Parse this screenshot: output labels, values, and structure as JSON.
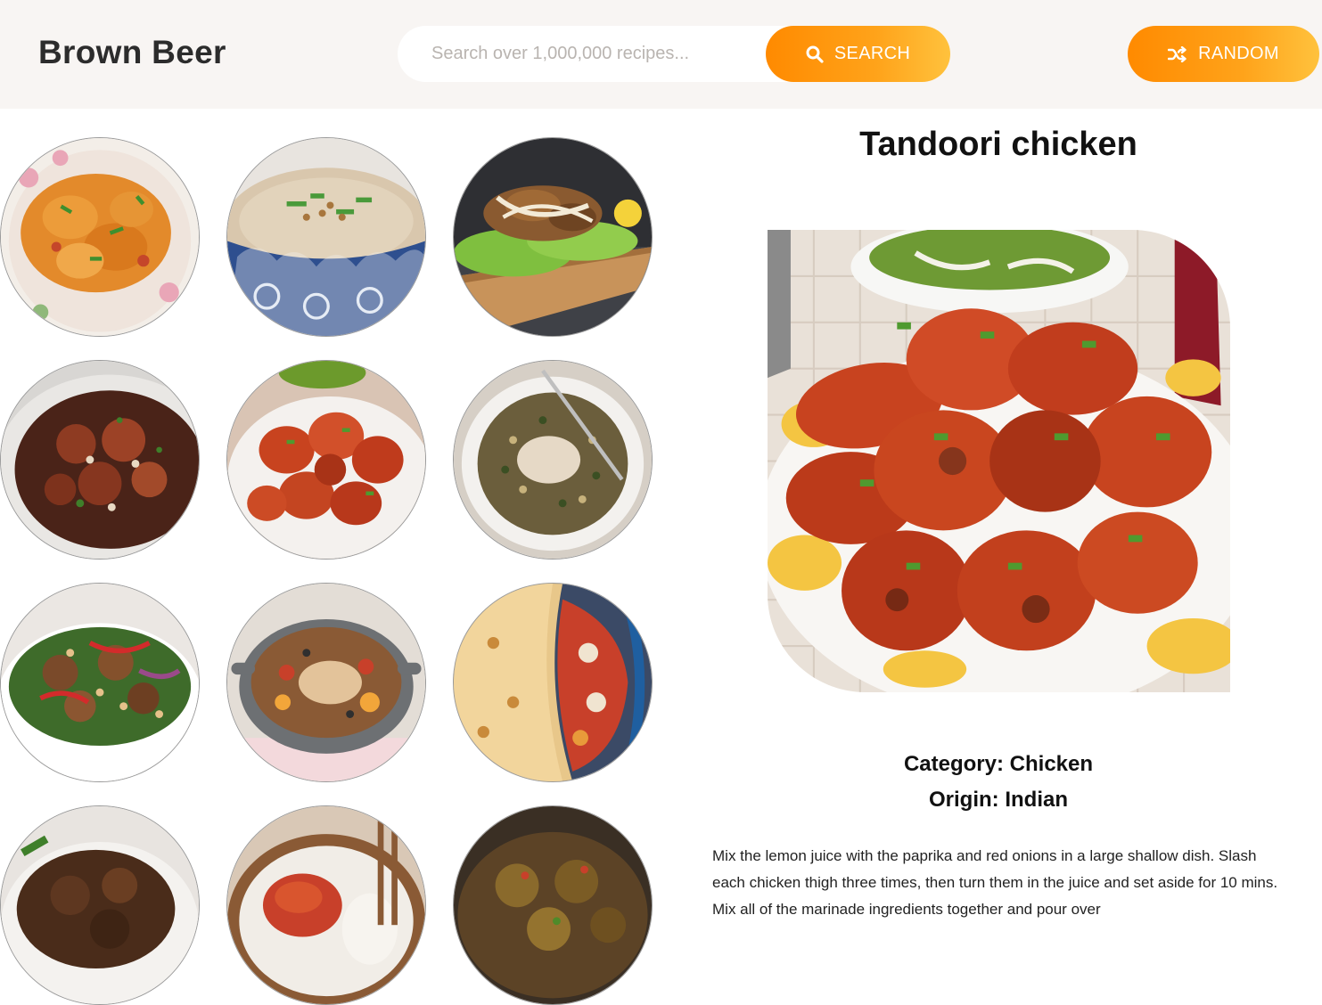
{
  "header": {
    "brand": "Brown Beer",
    "search": {
      "placeholder": "Search over 1,000,000 recipes...",
      "value": "",
      "button_label": "SEARCH",
      "button_icon": "search-icon"
    },
    "random": {
      "button_label": "RANDOM",
      "button_icon": "shuffle-icon"
    },
    "accent_color": "#ff9a0d",
    "background_color": "#f8f5f3"
  },
  "recipes_grid": {
    "columns": 3,
    "visible_rows": 4,
    "items": [
      {
        "dish": "curry-chicken"
      },
      {
        "dish": "congee-bowl"
      },
      {
        "dish": "fried-chicken-lettuce"
      },
      {
        "dish": "braised-chicken-pan"
      },
      {
        "dish": "tandoori-chicken"
      },
      {
        "dish": "chicken-with-grains"
      },
      {
        "dish": "chicken-salad-bowl"
      },
      {
        "dish": "chicken-casserole"
      },
      {
        "dish": "chicken-pie"
      },
      {
        "dish": "dark-braised-chicken"
      },
      {
        "dish": "chicken-with-rice"
      },
      {
        "dish": "spiced-chicken-thighs"
      }
    ]
  },
  "detail": {
    "title": "Tandoori chicken",
    "category": "Category: Chicken",
    "origin": "Origin: Indian",
    "instructions": "Mix the lemon juice with the paprika and red onions in a large shallow dish. Slash each chicken thigh three times, then turn them in the juice and set aside for 10 mins. Mix all of the marinade ingredients together and pour over"
  }
}
